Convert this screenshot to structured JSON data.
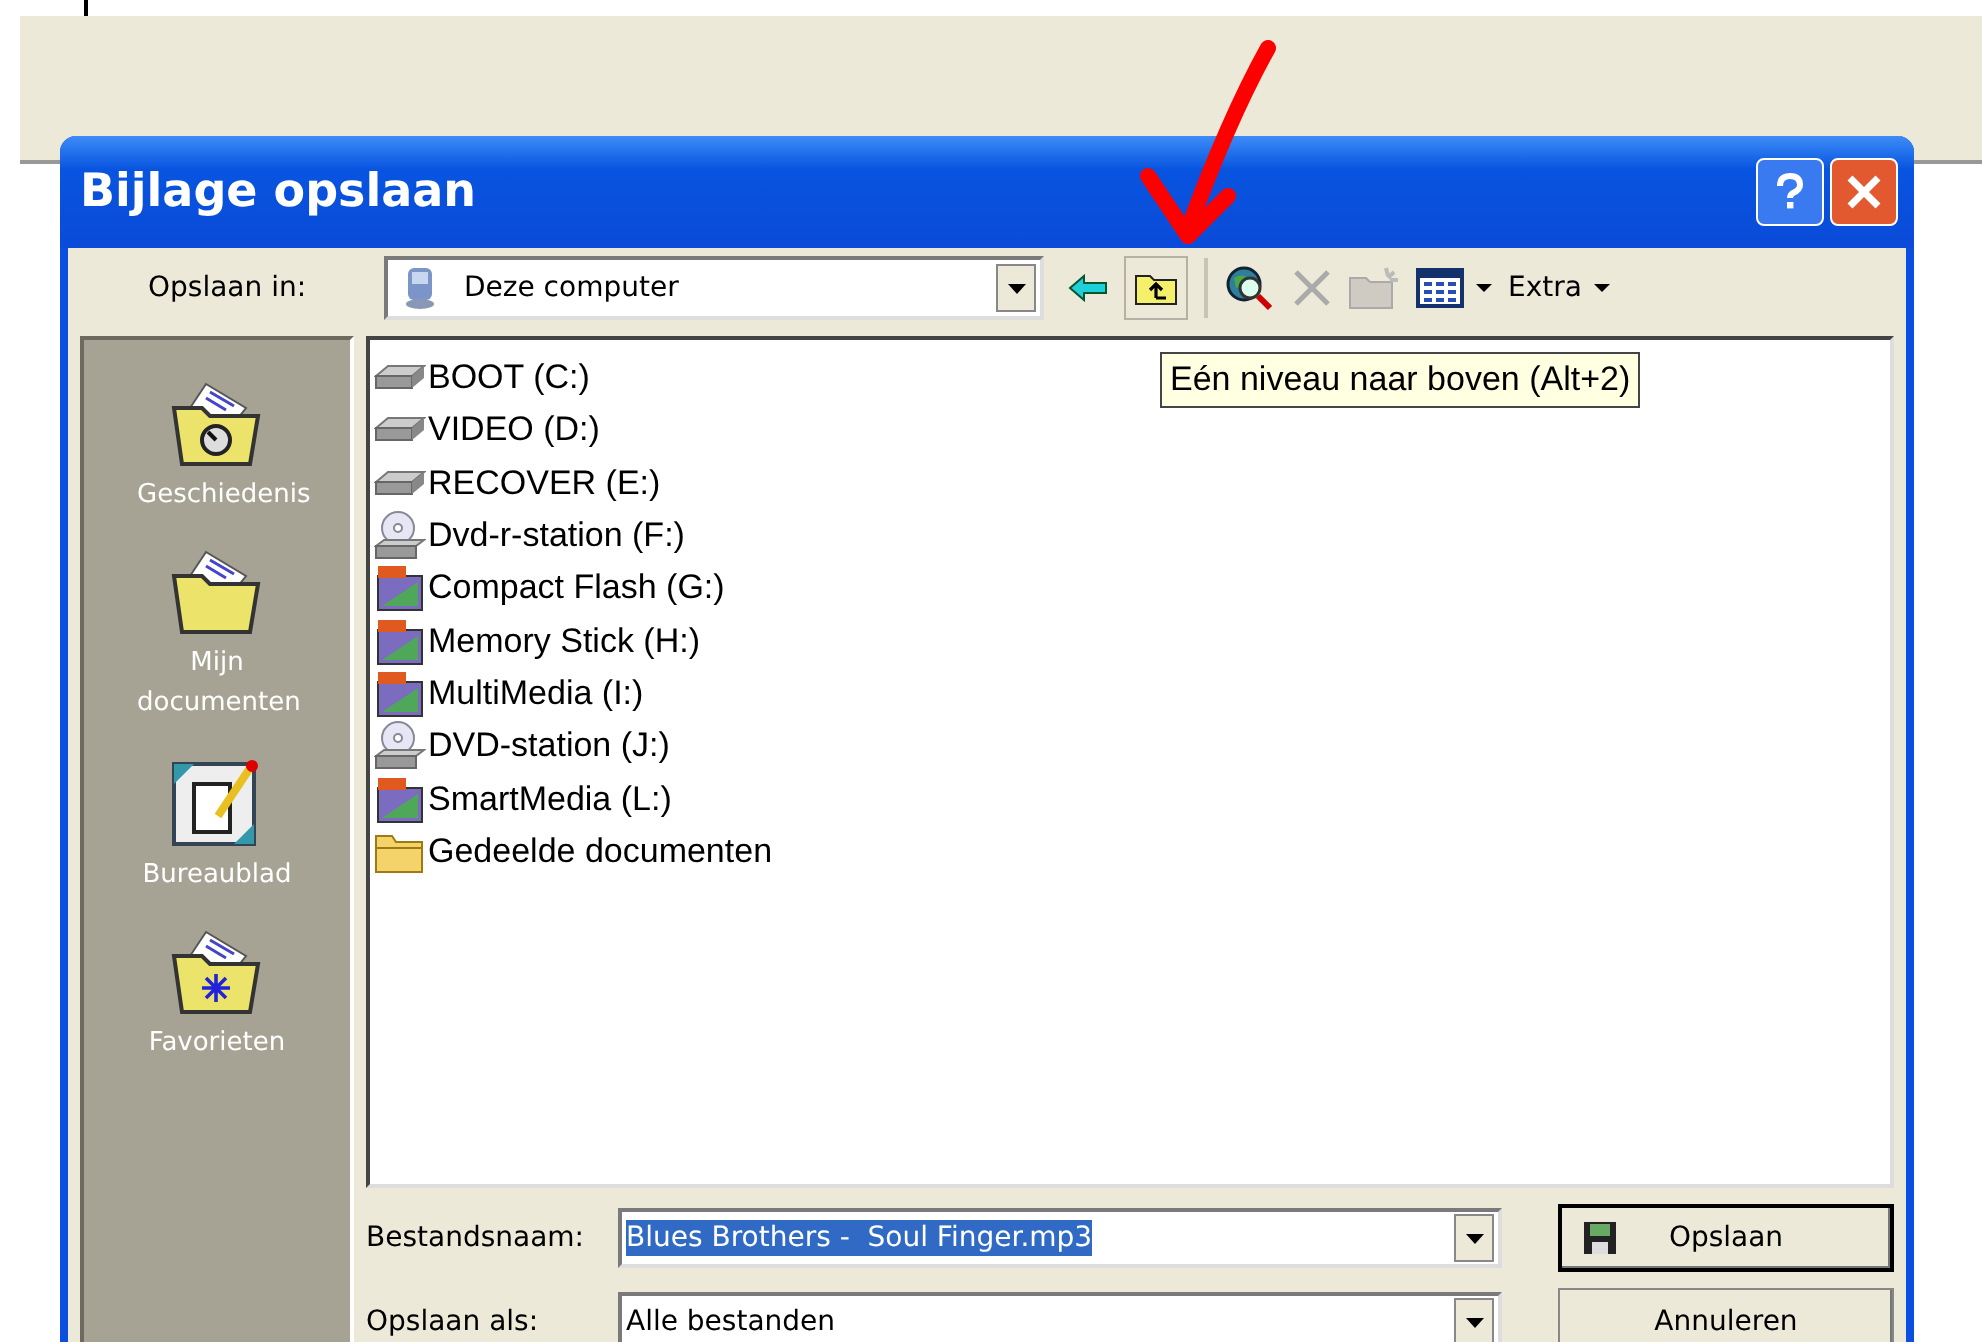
{
  "window": {
    "title": "Bijlage opslaan"
  },
  "location": {
    "label": "Opslaan in:",
    "value": "Deze computer"
  },
  "toolbar": {
    "extra_menu": "Extra"
  },
  "tooltip": "Eén niveau naar boven (Alt+2)",
  "places": [
    {
      "label": "Geschiedenis",
      "kind": "history"
    },
    {
      "label": "Mijn documenten",
      "kind": "documents"
    },
    {
      "label": "Bureaublad",
      "kind": "desktop"
    },
    {
      "label": "Favorieten",
      "kind": "favorites"
    }
  ],
  "files": [
    {
      "name": "BOOT (C:)",
      "kind": "drive"
    },
    {
      "name": "VIDEO (D:)",
      "kind": "drive"
    },
    {
      "name": "RECOVER (E:)",
      "kind": "drive"
    },
    {
      "name": "Dvd-r-station (F:)",
      "kind": "optical"
    },
    {
      "name": "Compact Flash (G:)",
      "kind": "card"
    },
    {
      "name": "Memory Stick (H:)",
      "kind": "card"
    },
    {
      "name": "MultiMedia (I:)",
      "kind": "card"
    },
    {
      "name": "DVD-station (J:)",
      "kind": "optical"
    },
    {
      "name": "SmartMedia (L:)",
      "kind": "card"
    },
    {
      "name": "Gedeelde documenten",
      "kind": "folder"
    }
  ],
  "filename": {
    "label": "Bestandsnaam:",
    "value": "Blues Brothers -  Soul Finger.mp3"
  },
  "filetype": {
    "label": "Opslaan als:",
    "value": "Alle bestanden"
  },
  "buttons": [
    {
      "label": "Opslaan",
      "kind": "save"
    },
    {
      "label": "Annuleren",
      "kind": "cancel"
    }
  ]
}
